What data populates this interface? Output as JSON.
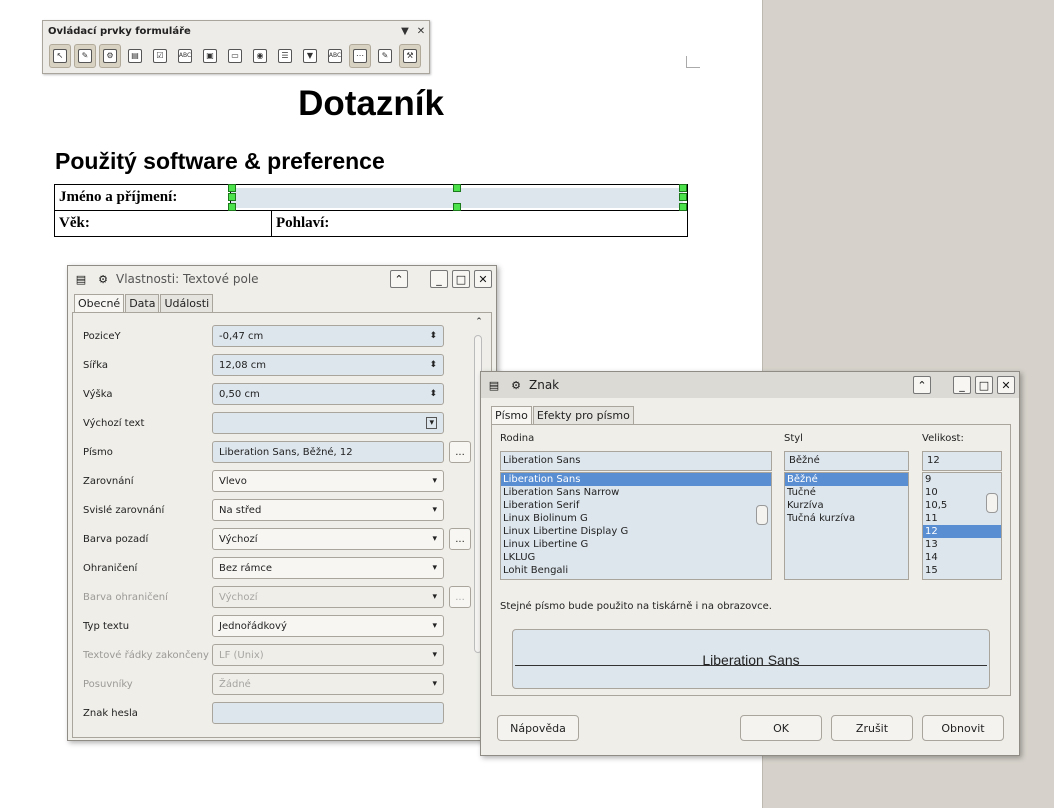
{
  "toolbar": {
    "title": "Ovládací prvky formuláře",
    "menu_glyph": "▼",
    "close_glyph": "✕",
    "icons": [
      {
        "name": "select-icon",
        "glyph": "↖",
        "on": true
      },
      {
        "name": "design-mode-icon",
        "glyph": "✎",
        "on": true
      },
      {
        "name": "control-wizards-icon",
        "glyph": "⚙",
        "on": true
      },
      {
        "name": "form-design-icon",
        "glyph": "▤",
        "on": false
      },
      {
        "name": "checkbox-icon",
        "glyph": "☑",
        "on": false
      },
      {
        "name": "text-box-icon",
        "glyph": "ABC",
        "on": false
      },
      {
        "name": "formatted-field-icon",
        "glyph": "▣",
        "on": false
      },
      {
        "name": "push-button-icon",
        "glyph": "▭",
        "on": false
      },
      {
        "name": "option-button-icon",
        "glyph": "◉",
        "on": false
      },
      {
        "name": "list-box-icon",
        "glyph": "☰",
        "on": false
      },
      {
        "name": "combo-box-icon",
        "glyph": "▼",
        "on": false
      },
      {
        "name": "label-field-icon",
        "glyph": "ABC",
        "on": false
      },
      {
        "name": "more-controls-icon",
        "glyph": "⋯",
        "on": true
      },
      {
        "name": "form-properties-icon",
        "glyph": "✎",
        "on": false
      },
      {
        "name": "control-properties-icon",
        "glyph": "⚒",
        "on": true
      }
    ]
  },
  "document": {
    "title": "Dotazník",
    "heading": "Použitý software & preference",
    "rows": {
      "name_label": "Jméno a příjmení:",
      "age_label": "Věk:",
      "gender_label": "Pohlaví:"
    }
  },
  "properties": {
    "title": "Vlastnosti: Textové pole",
    "tabs": [
      "Obecné",
      "Data",
      "Události"
    ],
    "rows": [
      {
        "label": "PoziceY",
        "value": "-0,47 cm",
        "kind": "spin",
        "disabled": false,
        "dots": false
      },
      {
        "label": "Šířka",
        "value": "12,08 cm",
        "kind": "spin",
        "disabled": false,
        "dots": false
      },
      {
        "label": "Výška",
        "value": "0,50 cm",
        "kind": "spin",
        "disabled": false,
        "dots": false
      },
      {
        "label": "Výchozí text",
        "value": "",
        "kind": "combo",
        "disabled": false,
        "dots": false
      },
      {
        "label": "Písmo",
        "value": "Liberation Sans, Běžné, 12",
        "kind": "text",
        "disabled": false,
        "dots": true
      },
      {
        "label": "Zarovnání",
        "value": "Vlevo",
        "kind": "drop",
        "disabled": false,
        "dots": false
      },
      {
        "label": "Svislé zarovnání",
        "value": "Na střed",
        "kind": "drop",
        "disabled": false,
        "dots": false
      },
      {
        "label": "Barva pozadí",
        "value": "Výchozí",
        "kind": "drop",
        "disabled": false,
        "dots": true
      },
      {
        "label": "Ohraničení",
        "value": "Bez rámce",
        "kind": "drop",
        "disabled": false,
        "dots": false
      },
      {
        "label": "Barva ohraničení",
        "value": "Výchozí",
        "kind": "drop",
        "disabled": true,
        "dots": true
      },
      {
        "label": "Typ textu",
        "value": "Jednořádkový",
        "kind": "drop",
        "disabled": false,
        "dots": false
      },
      {
        "label": "Textové řádky zakončeny",
        "value": "LF (Unix)",
        "kind": "drop",
        "disabled": true,
        "dots": false
      },
      {
        "label": "Posuvníky",
        "value": "Žádné",
        "kind": "drop",
        "disabled": true,
        "dots": false
      },
      {
        "label": "Znak hesla",
        "value": "",
        "kind": "text",
        "disabled": false,
        "dots": false
      }
    ]
  },
  "font_dialog": {
    "title": "Znak",
    "tabs": [
      "Písmo",
      "Efekty pro písmo"
    ],
    "family_label": "Rodina",
    "style_label": "Styl",
    "size_label": "Velikost:",
    "family_value": "Liberation Sans",
    "style_value": "Běžné",
    "size_value": "12",
    "families": [
      "Liberation Sans",
      "Liberation Sans Narrow",
      "Liberation Serif",
      "Linux Biolinum G",
      "Linux Libertine Display G",
      "Linux Libertine G",
      "LKLUG",
      "Lohit Bengali"
    ],
    "styles": [
      "Běžné",
      "Tučné",
      "Kurzíva",
      "Tučná kurzíva"
    ],
    "sizes": [
      "9",
      "10",
      "10,5",
      "11",
      "12",
      "13",
      "14",
      "15"
    ],
    "selected_family": 0,
    "selected_style": 0,
    "selected_size": 4,
    "note": "Stejné písmo bude použito na tiskárně i na obrazovce.",
    "preview": "Liberation Sans",
    "buttons": {
      "help": "Nápověda",
      "ok": "OK",
      "cancel": "Zrušit",
      "reset": "Obnovit"
    }
  }
}
